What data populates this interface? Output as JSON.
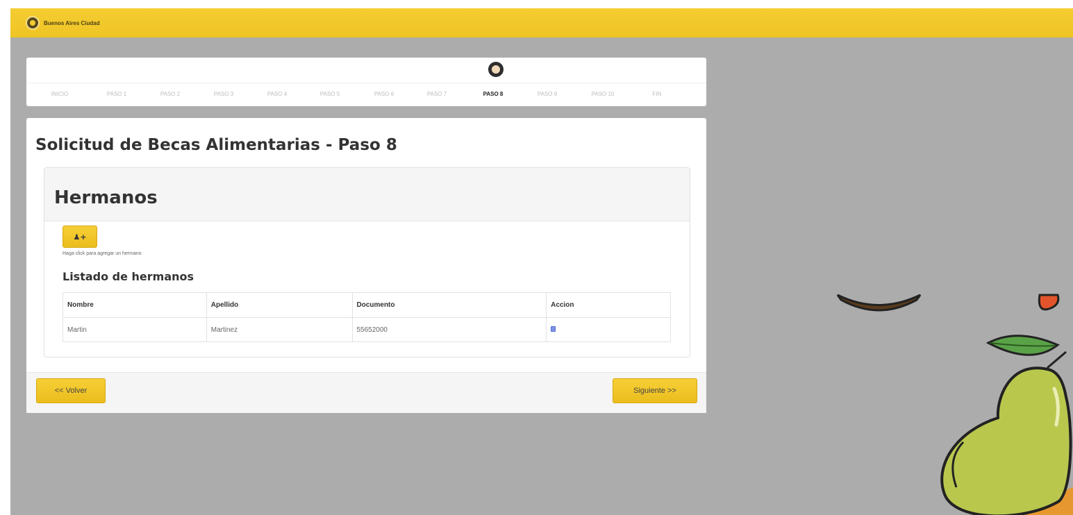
{
  "header": {
    "brand_name": "Buenos Aires Ciudad"
  },
  "steps": [
    {
      "label": "INICIO",
      "active": false
    },
    {
      "label": "PASO 1",
      "active": false
    },
    {
      "label": "PASO 2",
      "active": false
    },
    {
      "label": "PASO 3",
      "active": false
    },
    {
      "label": "PASO 4",
      "active": false
    },
    {
      "label": "PASO 5",
      "active": false
    },
    {
      "label": "PASO 6",
      "active": false
    },
    {
      "label": "PASO 7",
      "active": false
    },
    {
      "label": "PASO 8",
      "active": true
    },
    {
      "label": "PASO 9",
      "active": false
    },
    {
      "label": "PASO 10",
      "active": false
    },
    {
      "label": "FIN",
      "active": false
    }
  ],
  "main": {
    "title": "Solicitud de Becas Alimentarias - Paso 8",
    "card": {
      "title": "Hermanos",
      "add_button_icon": "add-user-icon",
      "help_text": "Haga click para agregar un hermano",
      "list_title": "Listado de hermanos",
      "table": {
        "headers": [
          "Nombre",
          "Apellido",
          "Documento",
          "Accion"
        ],
        "rows": [
          {
            "nombre": "Martin",
            "apellido": "Martinez",
            "documento": "55652000",
            "accion_icon": "trash-icon"
          }
        ]
      }
    }
  },
  "footer": {
    "back_label": "<< Volver",
    "next_label": "Siguiente >>"
  },
  "colors": {
    "accent": "#F2C82E",
    "background": "#ACACAC",
    "panel": "#FFFFFF",
    "action_icon": "#5B73D8"
  }
}
